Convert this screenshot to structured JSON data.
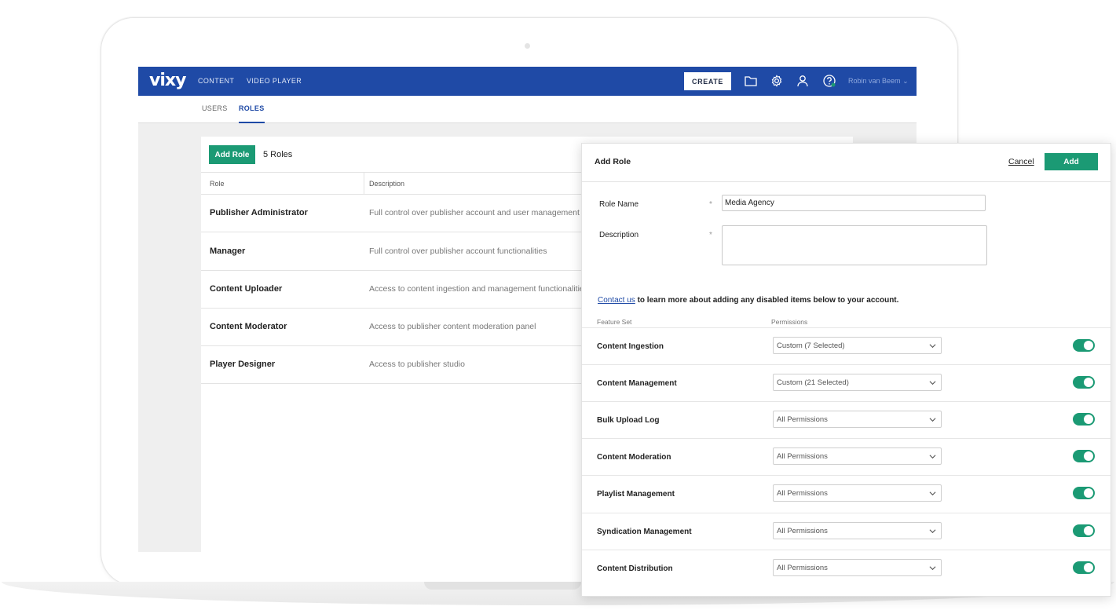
{
  "app": {
    "logo": "vixy",
    "nav": [
      "CONTENT",
      "VIDEO PLAYER"
    ],
    "create_label": "CREATE",
    "user_name": "Robin van Beem",
    "icons": [
      "folder-icon",
      "gear-icon",
      "user-icon",
      "help-icon"
    ]
  },
  "tabs": [
    "USERS",
    "ROLES"
  ],
  "active_tab": "ROLES",
  "roles": {
    "add_label": "Add Role",
    "count_label": "5 Roles",
    "headers": {
      "role": "Role",
      "description": "Description"
    },
    "rows": [
      {
        "role": "Publisher Administrator",
        "description": "Full control over publisher account and user management fu"
      },
      {
        "role": "Manager",
        "description": "Full control over publisher account functionalities"
      },
      {
        "role": "Content Uploader",
        "description": "Access to content ingestion and management functionalities"
      },
      {
        "role": "Content Moderator",
        "description": "Access to publisher content moderation panel"
      },
      {
        "role": "Player Designer",
        "description": "Access to publisher studio"
      }
    ]
  },
  "modal": {
    "title": "Add Role",
    "cancel_label": "Cancel",
    "add_label": "Add",
    "role_name_label": "Role Name",
    "role_name_value": "Media Agency",
    "description_label": "Description",
    "required_mark": "*",
    "contact_link": "Contact us",
    "contact_text": " to learn more about adding any disabled items below to your account.",
    "feature_set_label": "Feature Set",
    "permissions_label": "Permissions",
    "features": [
      {
        "name": "Content Ingestion",
        "permission": "Custom (7 Selected)",
        "enabled": true
      },
      {
        "name": "Content Management",
        "permission": "Custom (21 Selected)",
        "enabled": true
      },
      {
        "name": "Bulk Upload Log",
        "permission": "All Permissions",
        "enabled": true
      },
      {
        "name": "Content Moderation",
        "permission": "All Permissions",
        "enabled": true
      },
      {
        "name": "Playlist Management",
        "permission": "All Permissions",
        "enabled": true
      },
      {
        "name": "Syndication Management",
        "permission": "All Permissions",
        "enabled": true
      },
      {
        "name": "Content Distribution",
        "permission": "All Permissions",
        "enabled": true
      }
    ]
  },
  "colors": {
    "brand_blue": "#1f4aa6",
    "accent_green": "#1b9a74"
  }
}
